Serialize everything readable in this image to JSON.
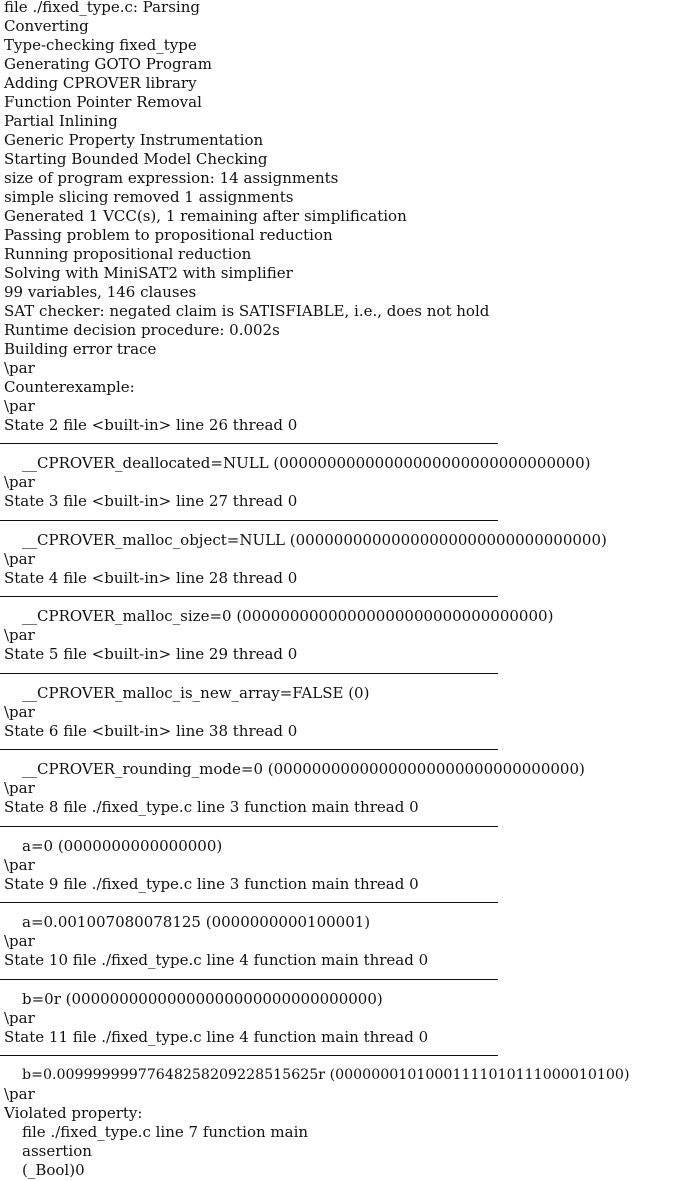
{
  "log_lines": [
    "file ./fixed_type.c: Parsing",
    "Converting",
    "Type-checking fixed_type",
    "Generating GOTO Program",
    "Adding CPROVER library",
    "Function Pointer Removal",
    "Partial Inlining",
    "Generic Property Instrumentation",
    "Starting Bounded Model Checking",
    "size of program expression: 14 assignments",
    "simple slicing removed 1 assignments",
    "Generated 1 VCC(s), 1 remaining after simplification",
    "Passing problem to propositional reduction",
    "Running propositional reduction",
    "Solving with MiniSAT2 with simplifier",
    "99 variables, 146 clauses",
    "SAT checker: negated claim is SATISFIABLE, i.e., does not hold",
    "Runtime decision procedure: 0.002s",
    "Building error trace",
    "\\par",
    "Counterexample:",
    "\\par"
  ],
  "states": [
    {
      "header": "State 2 file <built-in> line 26 thread 0",
      "value": "__CPROVER_deallocated=NULL (00000000000000000000000000000000)",
      "after": "\\par"
    },
    {
      "header": "State 3 file <built-in> line 27 thread 0",
      "value": "__CPROVER_malloc_object=NULL (00000000000000000000000000000000)",
      "after": "\\par"
    },
    {
      "header": "State 4 file <built-in> line 28 thread 0",
      "value": "__CPROVER_malloc_size=0 (00000000000000000000000000000000)",
      "after": "\\par"
    },
    {
      "header": "State 5 file <built-in> line 29 thread 0",
      "value": "__CPROVER_malloc_is_new_array=FALSE (0)",
      "after": "\\par"
    },
    {
      "header": "State 6 file <built-in> line 38 thread 0",
      "value": "__CPROVER_rounding_mode=0 (00000000000000000000000000000000)",
      "after": "\\par"
    },
    {
      "header": "State 8 file ./fixed_type.c line 3 function main thread 0",
      "value": "a=0 (0000000000000000)",
      "after": "\\par"
    },
    {
      "header": "State 9 file ./fixed_type.c line 3 function main thread 0",
      "value": "a=0.001007080078125 (0000000000100001)",
      "after": "\\par"
    },
    {
      "header": "State 10 file ./fixed_type.c line 4 function main thread 0",
      "value": "b=0r (00000000000000000000000000000000)",
      "after": "\\par"
    },
    {
      "header": "State 11 file ./fixed_type.c line 4 function main thread 0",
      "value": "b=0.00999999977648258209228515625r (00000001010001111010111000010100)",
      "after": "\\par"
    }
  ],
  "violation": {
    "title": "Violated property:",
    "location": "file ./fixed_type.c line 7 function main",
    "kind": "assertion",
    "expression": "(_Bool)0"
  }
}
